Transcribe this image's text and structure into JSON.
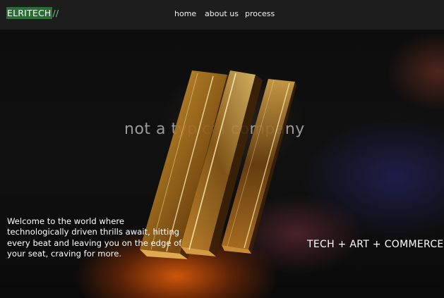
{
  "brand": {
    "logo_text": "ELRITECH",
    "logo_mark": "//",
    "accent_color": "#2a6e35"
  },
  "nav": {
    "home": "home",
    "about": "about us",
    "process": "process"
  },
  "hero": {
    "tagline": "not a typical company",
    "welcome": "Welcome to the world where technologically driven thrills await, hitting every beat and leaving you on the edge of your seat, craving for more.",
    "slogan": "TECH + ART + COMMERCE"
  }
}
